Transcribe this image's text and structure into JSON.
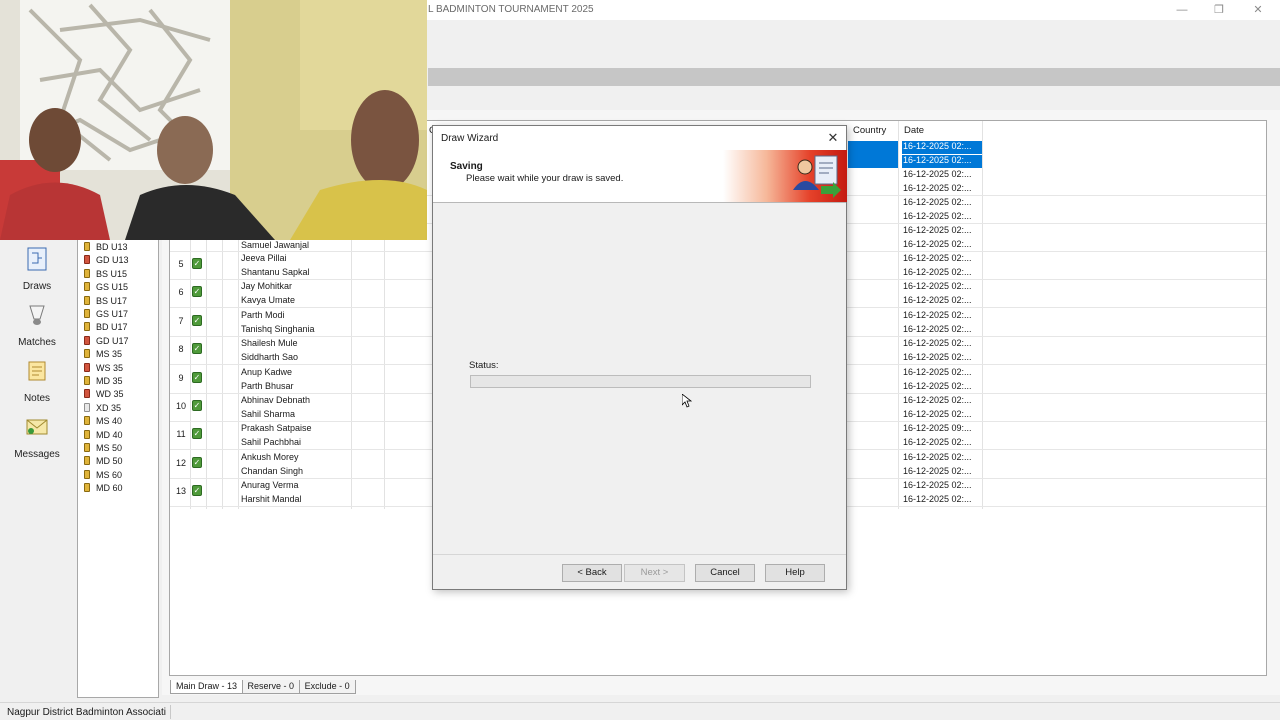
{
  "window": {
    "title": "L BADMINTON TOURNAMENT 2025",
    "min_glyph": "—",
    "max_glyph": "❐",
    "close_glyph": "✕"
  },
  "nav": {
    "items": [
      {
        "label": "Draws",
        "icon": "draws-icon"
      },
      {
        "label": "Matches",
        "icon": "shuttlecock-icon"
      },
      {
        "label": "Notes",
        "icon": "notes-icon"
      },
      {
        "label": "Messages",
        "icon": "messages-icon"
      }
    ]
  },
  "events": [
    {
      "label": "BD U13",
      "color": "yellow"
    },
    {
      "label": "GD U13",
      "color": "red"
    },
    {
      "label": "BS U15",
      "color": "yellow"
    },
    {
      "label": "GS U15",
      "color": "yellow"
    },
    {
      "label": "BS U17",
      "color": "yellow"
    },
    {
      "label": "GS U17",
      "color": "yellow"
    },
    {
      "label": "BD U17",
      "color": "yellow"
    },
    {
      "label": "GD U17",
      "color": "red"
    },
    {
      "label": "MS 35",
      "color": "yellow"
    },
    {
      "label": "WS 35",
      "color": "red"
    },
    {
      "label": "MD 35",
      "color": "yellow"
    },
    {
      "label": "WD 35",
      "color": "red"
    },
    {
      "label": "XD 35",
      "color": "grey"
    },
    {
      "label": "MS 40",
      "color": "yellow"
    },
    {
      "label": "MD 40",
      "color": "yellow"
    },
    {
      "label": "MS 50",
      "color": "yellow"
    },
    {
      "label": "MD 50",
      "color": "yellow"
    },
    {
      "label": "MS 60",
      "color": "yellow"
    },
    {
      "label": "MD 60",
      "color": "yellow"
    }
  ],
  "grid": {
    "headers": {
      "c": "C",
      "country": "Country",
      "date": "Date"
    },
    "top_dates": [
      "16-12-2025 02:...",
      "16-12-2025 02:...",
      "16-12-2025 02:...",
      "16-12-2025 02:...",
      "16-12-2025 02:...",
      "16-12-2025 02:...",
      "16-12-2025 02:...",
      "16-12-2025 02:..."
    ],
    "partial_name": "Samuel Jawanjal",
    "rows": [
      {
        "num": "5",
        "p1": "Jeeva Pillai",
        "p2": "Shantanu Sapkal",
        "d1": "16-12-2025 02:...",
        "d2": "16-12-2025 02:..."
      },
      {
        "num": "6",
        "p1": "Jay Mohitkar",
        "p2": "Kavya Umate",
        "d1": "16-12-2025 02:...",
        "d2": "16-12-2025 02:..."
      },
      {
        "num": "7",
        "p1": "Parth Modi",
        "p2": "Tanishq Singhania",
        "d1": "16-12-2025 02:...",
        "d2": "16-12-2025 02:..."
      },
      {
        "num": "8",
        "p1": "Shailesh Mule",
        "p2": "Siddharth Sao",
        "d1": "16-12-2025 02:...",
        "d2": "16-12-2025 02:..."
      },
      {
        "num": "9",
        "p1": "Anup Kadwe",
        "p2": "Parth Bhusar",
        "d1": "16-12-2025 02:...",
        "d2": "16-12-2025 02:..."
      },
      {
        "num": "10",
        "p1": "Abhinav Debnath",
        "p2": "Sahil Sharma",
        "d1": "16-12-2025 02:...",
        "d2": "16-12-2025 02:..."
      },
      {
        "num": "11",
        "p1": "Prakash Satpaise",
        "p2": "Sahil Pachbhai",
        "d1": "16-12-2025 09:...",
        "d2": "16-12-2025 02:..."
      },
      {
        "num": "12",
        "p1": "Ankush Morey",
        "p2": "Chandan Singh",
        "d1": "16-12-2025 02:...",
        "d2": "16-12-2025 02:..."
      },
      {
        "num": "13",
        "p1": "Anurag Verma",
        "p2": "Harshit Mandal",
        "d1": "16-12-2025 02:...",
        "d2": "16-12-2025 02:..."
      }
    ]
  },
  "tabs": [
    "Main Draw - 13",
    "Reserve - 0",
    "Exclude - 0"
  ],
  "statusbar": {
    "text": "Nagpur District Badminton Associati"
  },
  "dialog": {
    "title": "Draw Wizard",
    "heading": "Saving",
    "subheading": "Please wait while your draw is saved.",
    "status_label": "Status:",
    "progress": 0,
    "buttons": {
      "back": "< Back",
      "next": "Next >",
      "cancel": "Cancel",
      "help": "Help"
    }
  }
}
